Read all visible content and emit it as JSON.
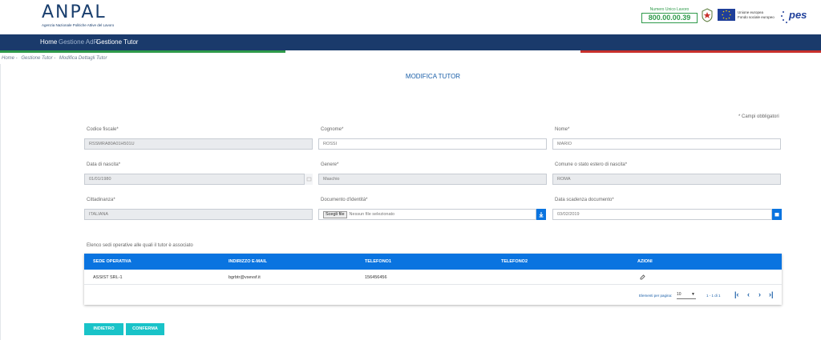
{
  "header": {
    "logo_text": "ANPAL",
    "logo_subtitle": "Agenzia Nazionale Politiche Attive del Lavoro",
    "numero_label": "Numero Unico Lavoro",
    "numero_value": "800.00.00.39",
    "eu_text_1": "Unione europea",
    "eu_text_2": "Fondo sociale europeo",
    "pes_text": "pes"
  },
  "nav": {
    "home": "Home",
    "gestione_adr": "Gestione AdR",
    "gestione_tutor": "Gestione Tutor"
  },
  "breadcrumb": [
    "Home -",
    "Gestione Tutor -",
    "Modifica Dettagli Tutor"
  ],
  "page_title": "MODIFICA TUTOR",
  "required_note": "* Campi obbligatori",
  "form": {
    "codice_fiscale": {
      "label": "Codice fiscale*",
      "value": "RSSMRA80A01H501U"
    },
    "cognome": {
      "label": "Cognome*",
      "value": "ROSSI"
    },
    "nome": {
      "label": "Nome*",
      "value": "MARIO"
    },
    "data_nascita": {
      "label": "Data di nascita*",
      "value": "01/01/1980"
    },
    "genere": {
      "label": "Genere*",
      "value": "Maschio"
    },
    "comune": {
      "label": "Comune o stato estero di nascita*",
      "value": "ROMA"
    },
    "cittadinanza": {
      "label": "Cittadinanza*",
      "value": "ITALIANA"
    },
    "documento": {
      "label": "Documento d'identità*",
      "button": "Scegli file",
      "value": "Nessun file selezionato"
    },
    "scadenza": {
      "label": "Data scadenza documento*",
      "value": "03/02/2019"
    }
  },
  "table": {
    "caption": "Elenco sedi operative alle quali il tutor è associato",
    "headers": [
      "SEDE OPERATIVA",
      "INDIRIZZO E-MAIL",
      "TELEFONO1",
      "TELEFONO2",
      "AZIONI"
    ],
    "rows": [
      {
        "sede": "ASSIST SRL-1",
        "email": "bgrbtr@vsevsf.it",
        "tel1": "156456456",
        "tel2": ""
      }
    ],
    "pager": {
      "label": "Elementi per pagina:",
      "per_page": "10",
      "range": "1 - 1 di 1"
    }
  },
  "actions": {
    "indietro": "INDIETRO",
    "conferma": "CONFERMA"
  },
  "colors": {
    "navy": "#1a3a6b",
    "primary_blue": "#0a74e0",
    "teal": "#19c3c8",
    "green": "#2e9a4a",
    "red": "#c8302c"
  }
}
